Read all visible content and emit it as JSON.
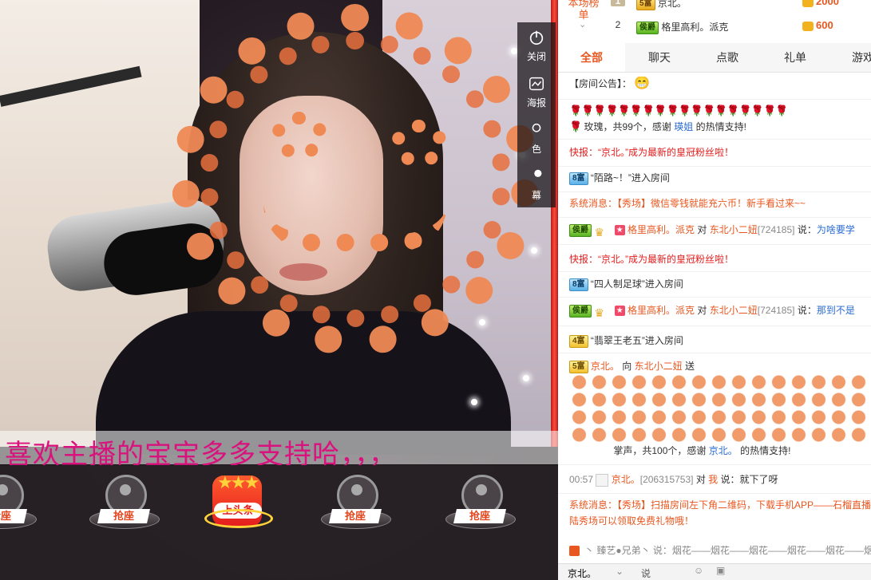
{
  "video": {
    "tools": [
      {
        "label": "关闭",
        "icon": "power-icon"
      },
      {
        "label": "海报",
        "icon": "poster-icon"
      },
      {
        "label": "色",
        "icon": "color-icon"
      },
      {
        "label": "幕",
        "icon": "screen-icon"
      }
    ],
    "caption": "喜欢主播的宝宝多多支持哈，，，",
    "seats": [
      "抢座",
      "抢座",
      "上头条",
      "抢座",
      "抢座"
    ]
  },
  "rank": {
    "title": "本场榜单",
    "rows": [
      {
        "num": "1",
        "level": "5富",
        "name": "京北。",
        "score": "2000"
      },
      {
        "num": "2",
        "level": "侯爵",
        "name": "格里高利。派克",
        "score": "600"
      }
    ]
  },
  "tabs": [
    "全部",
    "聊天",
    "点歌",
    "礼单",
    "游戏"
  ],
  "chat": {
    "notice_label": "【房间公告】：",
    "rose_msg_pre": "玫瑰，共99个，感谢",
    "rose_msg_user": "瑛姐",
    "rose_msg_post": "的热情支持!",
    "flash1": "快报：“京北。”成为最新的皇冠粉丝啦！",
    "enter1_level": "8富",
    "enter1_text": "“陌路~！”进入房间",
    "sys1": "系统消息：【秀场】微信零钱就能充六币！新手看过来~~",
    "chat1_level": "侯爵",
    "chat1_user": "格里高利。派克",
    "chat1_mid": "对",
    "chat1_target": "东北小二妞",
    "chat1_id": "[724185]",
    "chat1_say": "说：",
    "chat1_text": "为啥要学",
    "flash2": "快报：“京北。”成为最新的皇冠粉丝啦！",
    "enter2_level": "8富",
    "enter2_text": "“四人制足球”进入房间",
    "chat2_level": "侯爵",
    "chat2_user": "格里高利。派克",
    "chat2_mid": "对",
    "chat2_target": "东北小二妞",
    "chat2_id": "[724185]",
    "chat2_say": "说：",
    "chat2_text": "那到不是",
    "enter3_level": "4富",
    "enter3_text": "“翡翠王老五”进入房间",
    "gift_level": "5富",
    "gift_user": "京北。",
    "gift_mid": "向",
    "gift_target": "东北小二妞",
    "gift_verb": "送",
    "gift_msg_pre": "掌声，共100个，感谢",
    "gift_msg_user": "京北。",
    "gift_msg_post": "的热情支持!",
    "time": "00:57",
    "pm_user": "京北。",
    "pm_id": "[206315753]",
    "pm_mid": "对",
    "pm_target": "我",
    "pm_say": "说：",
    "pm_text": "就下了呀",
    "sys2_a": "系统消息：【秀场】扫描房间左下角二维码，下载手机APP——石榴直播",
    "sys2_b": "陆秀场可以领取免费礼物哦！",
    "fireworks": "丶 臻艺●兄弟丶 说：烟花——烟花——烟花——烟花——烟花——烟花"
  },
  "input": {
    "target": "京北。",
    "label": "说"
  },
  "colors": {
    "accent": "#e8571f",
    "caption": "#d9127d"
  }
}
